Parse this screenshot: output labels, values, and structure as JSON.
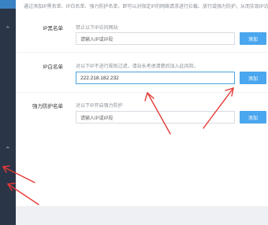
{
  "notice": "通过添加IP黑名单、IP白名单、强力防护名单，即可以对指定IP的网络请求进行拦截、放行或强力防护，从而实现IP访问控制",
  "sections": [
    {
      "label": "IP黑名单",
      "description": "禁止以下IP访问网站",
      "input_placeholder": "请输入IP或IP段",
      "input_value": "",
      "button": "添加"
    },
    {
      "label": "IP白名单",
      "description": "对以下IP不进行规则过滤，请站长考虑清楚后加入此风险。",
      "input_placeholder": "请输入IP或IP段",
      "input_value": "222.218.182.232",
      "button": "添加"
    },
    {
      "label": "强力防护名单",
      "description": "对以下IP开启强力防护",
      "input_placeholder": "请输入IP或IP段",
      "input_value": "",
      "button": "添加"
    }
  ],
  "colors": {
    "sidebar": "#2a3547",
    "accent": "#4aa6ee",
    "annotation_arrow": "#e53935"
  }
}
